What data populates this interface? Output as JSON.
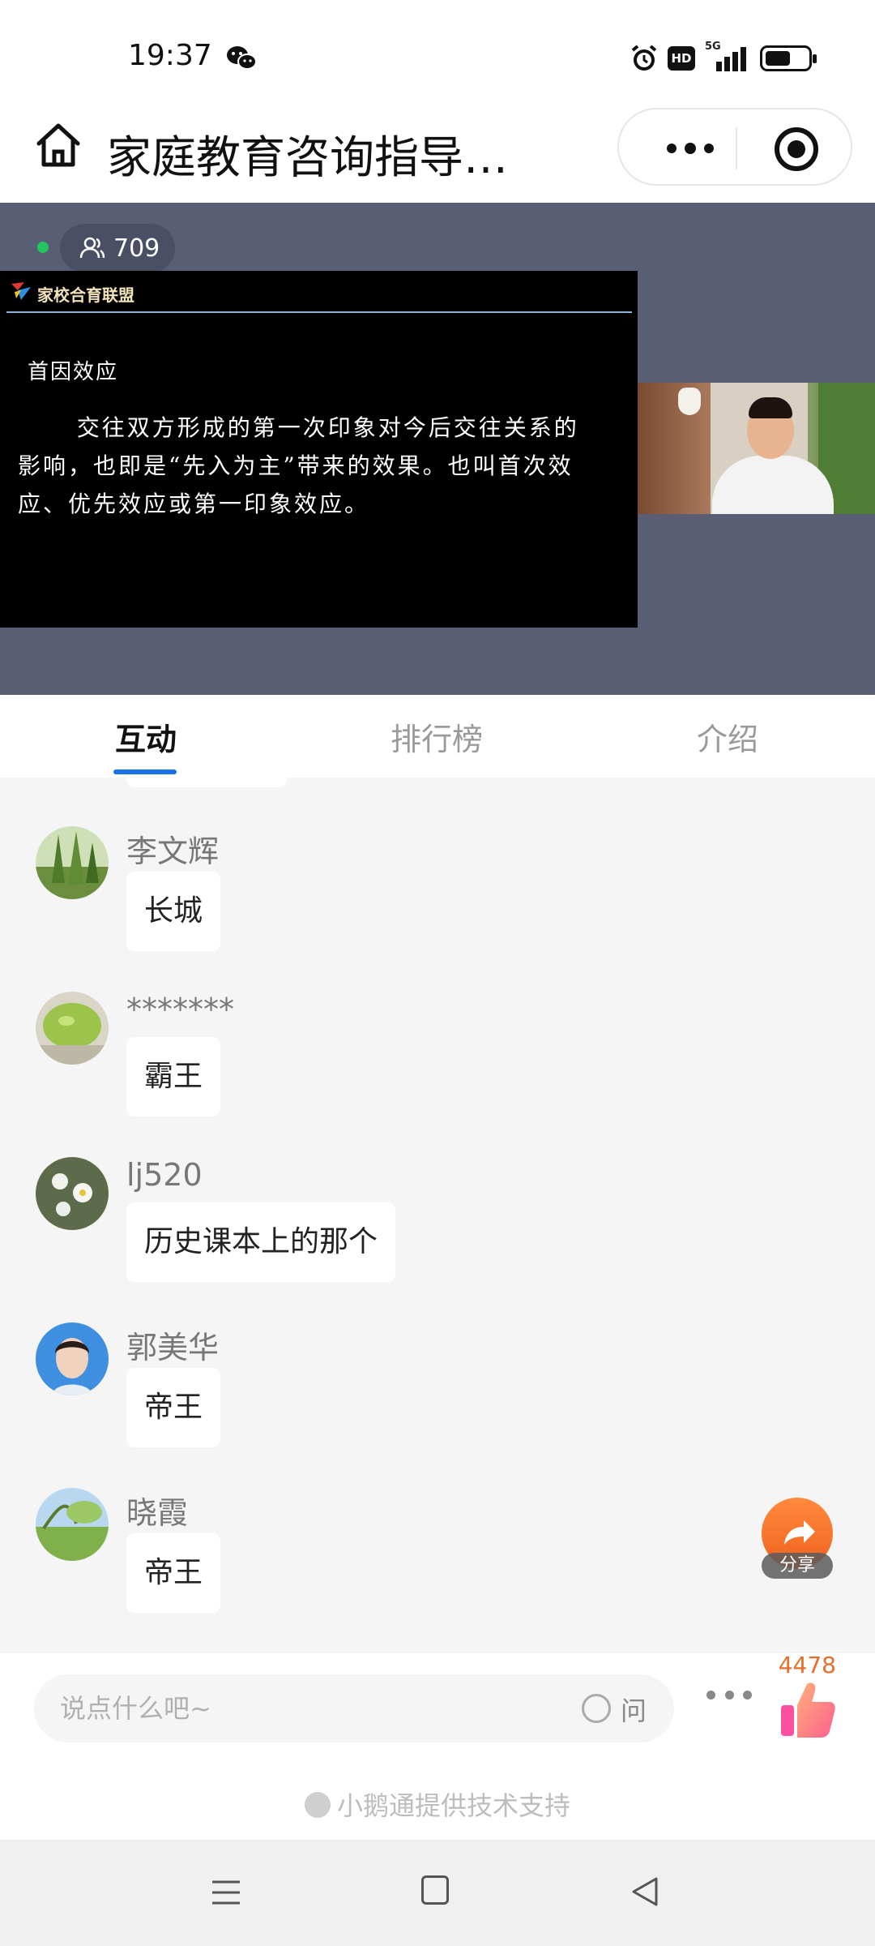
{
  "status_bar": {
    "time": "19:37",
    "network": "5G",
    "icons": [
      "wechat-icon",
      "alarm-icon",
      "hd-icon",
      "signal-icon",
      "battery-icon"
    ]
  },
  "header": {
    "title": "家庭教育咨询指导…",
    "icons": [
      "home-icon",
      "more-icon",
      "close-icon"
    ]
  },
  "video": {
    "viewer_count": "709",
    "slide": {
      "org_name": "家校合育联盟",
      "heading": "首因效应",
      "body": "交往双方形成的第一次印象对今后交往关系的影响，也即是“先入为主”带来的效果。也叫首次效应、优先效应或第一印象效应。"
    }
  },
  "tabs": [
    {
      "label": "互动",
      "active": true
    },
    {
      "label": "排行榜",
      "active": false
    },
    {
      "label": "介绍",
      "active": false
    }
  ],
  "messages": [
    {
      "name": "李文辉",
      "text": "长城",
      "avatar": "trees"
    },
    {
      "name": "*******",
      "text": "霸王",
      "avatar": "green-fruit"
    },
    {
      "name": "lj520",
      "text": "历史课本上的那个",
      "avatar": "white-flowers"
    },
    {
      "name": "郭美华",
      "text": "帝王",
      "avatar": "woman-portrait"
    },
    {
      "name": "晓霞",
      "text": "帝王",
      "avatar": "landscape"
    }
  ],
  "share": {
    "label": "分享"
  },
  "input": {
    "placeholder": "说点什么吧~",
    "ask_label": "问",
    "like_count": "4478"
  },
  "footer": {
    "support_text": "小鹅通提供技术支持"
  },
  "colors": {
    "accent_blue": "#1a73e8",
    "video_bg": "#5a5e74",
    "chat_bg": "#f5f5f6",
    "like_orange": "#e86f2a"
  }
}
